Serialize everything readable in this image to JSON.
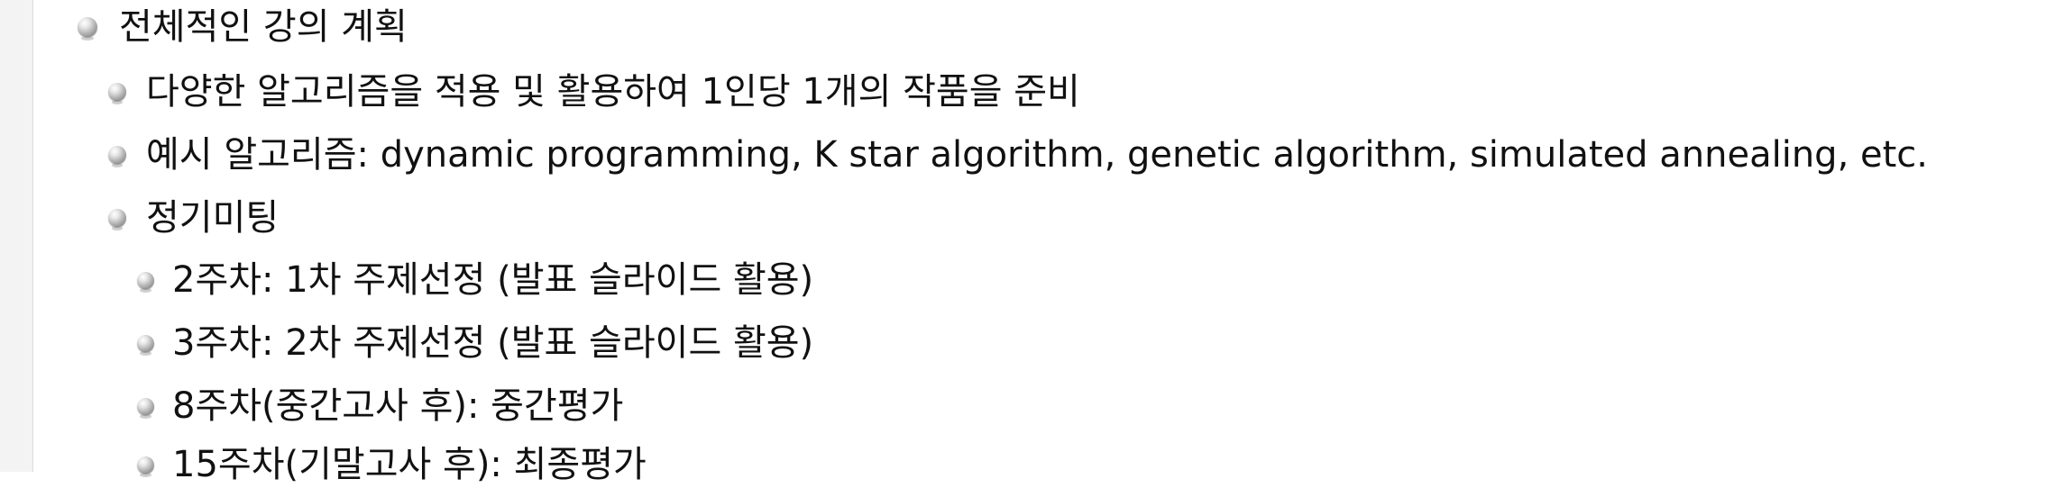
{
  "outline": {
    "level1": {
      "text": "전체적인 강의 계획"
    },
    "level2": [
      {
        "text": "다양한 알고리즘을 적용 및 활용하여 1인당 1개의 작품을 준비"
      },
      {
        "text": "예시 알고리즘: dynamic programming, K star algorithm, genetic algorithm, simulated annealing, etc."
      },
      {
        "text": "정기미팅"
      }
    ],
    "level3": [
      {
        "text": "2주차: 1차 주제선정 (발표 슬라이드 활용)"
      },
      {
        "text": "3주차: 2차 주제선정 (발표 슬라이드 활용)"
      },
      {
        "text": "8주차(중간고사 후): 중간평가"
      },
      {
        "text": "15주차(기말고사 후): 최종평가"
      }
    ]
  },
  "bullet_icon": "sphere-bullet-icon",
  "colors": {
    "text": "#111111",
    "bullet": "#9a9a9a",
    "background": "#ffffff"
  }
}
